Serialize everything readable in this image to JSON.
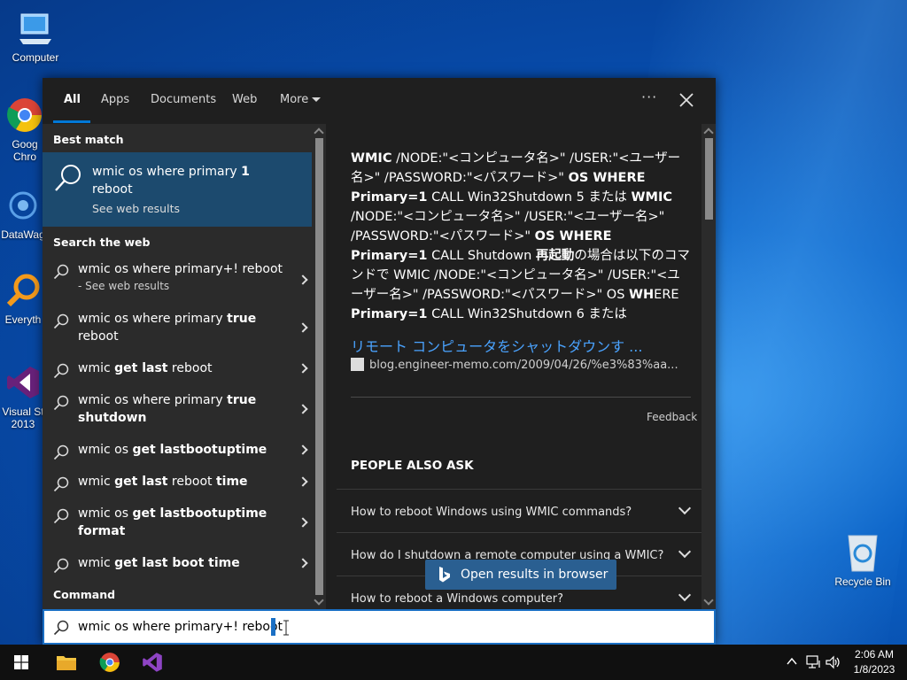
{
  "desktop": {
    "icons": [
      {
        "label": "Computer"
      },
      {
        "label": "Goog\nChro"
      },
      {
        "label": "DataWag"
      },
      {
        "label": "Everyth"
      },
      {
        "label": "Visual St\n2013"
      },
      {
        "label": "Recycle Bin"
      }
    ]
  },
  "search": {
    "tabs": [
      {
        "label": "All"
      },
      {
        "label": "Apps"
      },
      {
        "label": "Documents"
      },
      {
        "label": "Web"
      },
      {
        "label": "More"
      }
    ],
    "more_options": "···",
    "best_match_header": "Best match",
    "best_match": {
      "title_pre": "wmic os where primary ",
      "title_bold": "1",
      "title_post": "reboot",
      "subtitle": "See web results"
    },
    "search_web_header": "Search the web",
    "suggestions": [
      {
        "pre": "wmic os where primary+! reboot",
        "bold": "",
        "post": "",
        "sub": "- See web results"
      },
      {
        "pre": "wmic os where primary ",
        "bold": "true",
        "post": "reboot",
        "sub": ""
      },
      {
        "pre": "wmic ",
        "bold": "get last",
        "post": " reboot",
        "sub": ""
      },
      {
        "pre": "wmic os where primary ",
        "bold": "true shutdown",
        "post": "",
        "sub": ""
      },
      {
        "pre": "wmic os ",
        "bold": "get lastbootuptime",
        "post": "",
        "sub": ""
      },
      {
        "pre": "wmic ",
        "bold": "get last",
        "post": " reboot ",
        "bold2": "time",
        "sub": ""
      },
      {
        "pre": "wmic os ",
        "bold": "get lastbootuptime format",
        "post": "",
        "sub": ""
      },
      {
        "pre": "wmic ",
        "bold": "get last boot time",
        "post": "",
        "sub": ""
      }
    ],
    "command_header": "Command",
    "query": "wmic os where primary+! reboot",
    "preview": {
      "snippet_parts": [
        {
          "b": true,
          "t": "WMIC"
        },
        {
          "b": false,
          "t": " /NODE:\"<コンピュータ名>\" /USER:\"<ユーザー名>\" /PASSWORD:\"<パスワード>\" "
        },
        {
          "b": true,
          "t": "OS WHERE Primary=1"
        },
        {
          "b": false,
          "t": " CALL Win32Shutdown 5 または "
        },
        {
          "b": true,
          "t": "WMIC"
        },
        {
          "b": false,
          "t": " /NODE:\"<コンピュータ名>\" /USER:\"<ユーザー名>\" /PASSWORD:\"<パスワード>\" "
        },
        {
          "b": true,
          "t": "OS WHERE Primary=1"
        },
        {
          "b": false,
          "t": " CALL Shutdown "
        },
        {
          "b": true,
          "t": "再起動"
        },
        {
          "b": false,
          "t": "の場合は以下のコマンドで WMIC /NODE:\"<コンピュータ名>\" /USER:\"<ユーザー名>\" /PASSWORD:\"<パスワード>\" OS "
        },
        {
          "b": true,
          "t": "WH"
        },
        {
          "b": false,
          "t": "ERE "
        },
        {
          "b": true,
          "t": "Primary=1"
        },
        {
          "b": false,
          "t": " CALL Win32Shutdown 6 または"
        }
      ],
      "result_title": "リモート コンピュータをシャットダウンす ...",
      "result_url": "blog.engineer-memo.com/2009/04/26/%e3%83%aa...",
      "feedback": "Feedback",
      "people_also_ask": "PEOPLE ALSO ASK",
      "questions": [
        "How to reboot Windows using WMIC commands?",
        "How do I shutdown a remote computer using a WMIC?",
        "How to reboot a Windows computer?"
      ],
      "open_in_browser": "Open results in browser"
    }
  },
  "taskbar": {
    "time": "2:06 AM",
    "date": "1/8/2023"
  },
  "colors": {
    "accent": "#0078d7",
    "highlight": "#1c4a6e",
    "link": "#4aa3ff"
  }
}
